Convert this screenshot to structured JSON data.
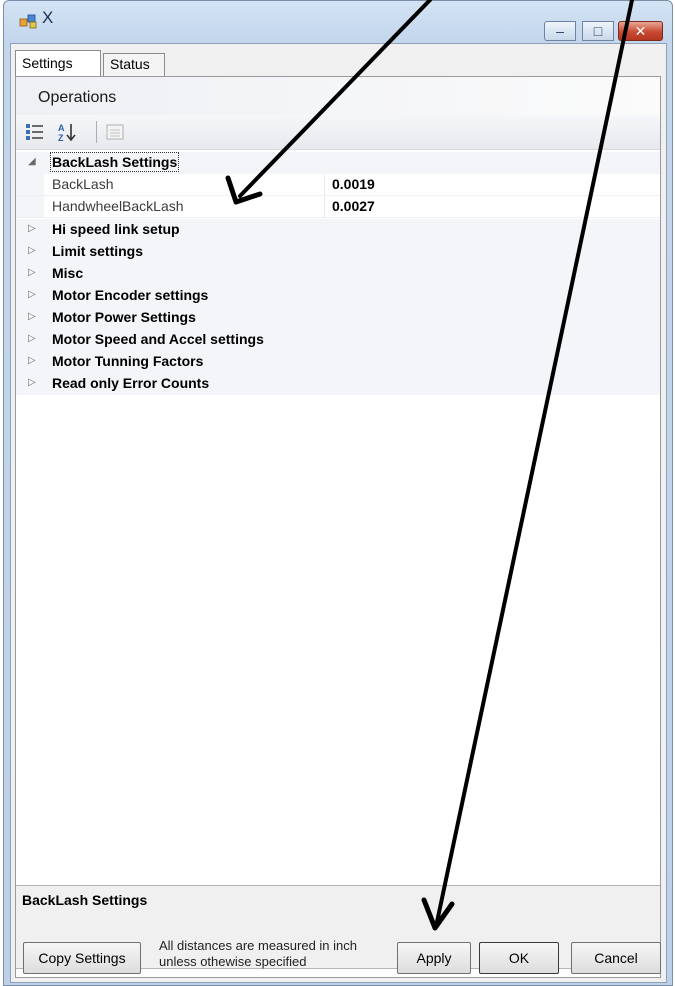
{
  "window": {
    "title": "X",
    "minimize_glyph": "–",
    "maximize_glyph": "□",
    "close_glyph": "✕"
  },
  "tabs": [
    {
      "label": "Settings",
      "active": true
    },
    {
      "label": "Status",
      "active": false
    }
  ],
  "panel": {
    "header": "Operations"
  },
  "toolbar": {
    "icons": [
      "categorized-view-icon",
      "alphabetical-sort-icon",
      "property-pages-icon"
    ],
    "az_glyph": "A\nZ"
  },
  "grid": {
    "categories": [
      {
        "label": "BackLash Settings",
        "expanded": true,
        "expander": "◢",
        "properties": [
          {
            "name": "BackLash",
            "value": "0.0019"
          },
          {
            "name": "HandwheelBackLash",
            "value": "0.0027"
          }
        ]
      },
      {
        "label": "Hi speed link setup",
        "expanded": false,
        "expander": "▷"
      },
      {
        "label": "Limit settings",
        "expanded": false,
        "expander": "▷"
      },
      {
        "label": "Misc",
        "expanded": false,
        "expander": "▷"
      },
      {
        "label": "Motor Encoder settings",
        "expanded": false,
        "expander": "▷"
      },
      {
        "label": "Motor Power Settings",
        "expanded": false,
        "expander": "▷"
      },
      {
        "label": "Motor Speed and Accel settings",
        "expanded": false,
        "expander": "▷"
      },
      {
        "label": "Motor Tunning Factors",
        "expanded": false,
        "expander": "▷"
      },
      {
        "label": "Read only Error Counts",
        "expanded": false,
        "expander": "▷"
      }
    ]
  },
  "description": {
    "title": "BackLash Settings"
  },
  "bottom": {
    "copy_label": "Copy Settings",
    "info_text": "All distances are measured in inch unless othewise specified",
    "apply_label": "Apply",
    "ok_label": "OK",
    "cancel_label": "Cancel"
  },
  "colors": {
    "annotation_arrow": "#000000",
    "close_button": "#c94a33"
  }
}
